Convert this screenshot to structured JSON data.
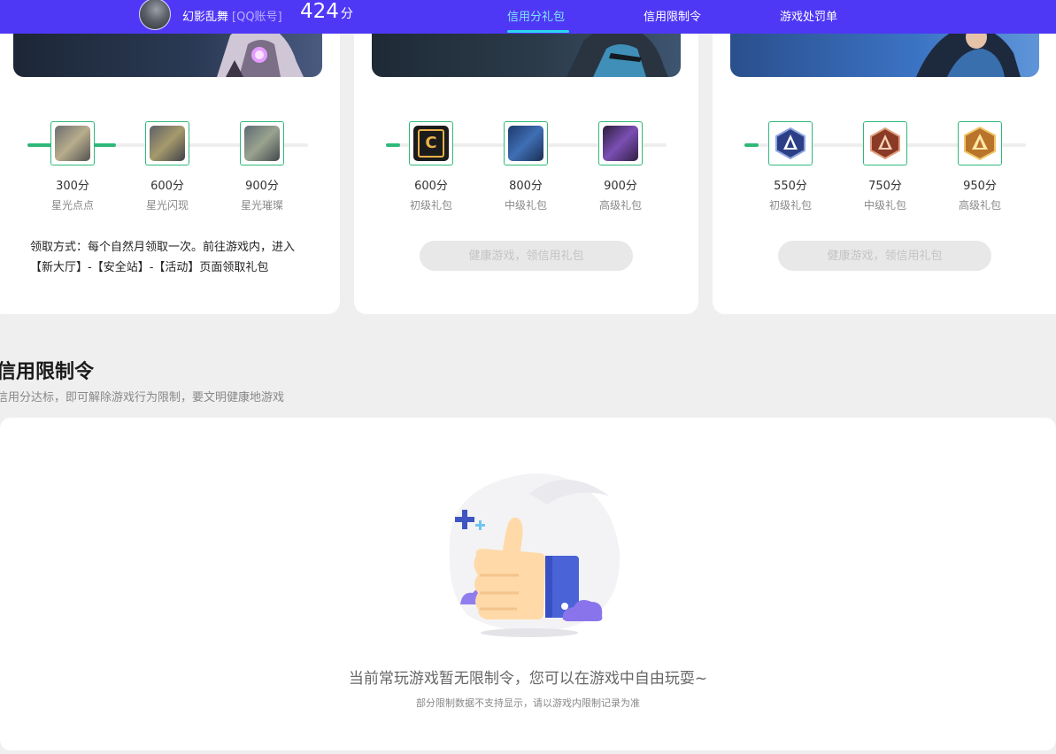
{
  "topbar": {
    "username": "幻影乱舞",
    "account_type": "[QQ账号]",
    "score": "424",
    "score_unit": "分",
    "nav": [
      {
        "label": "信用分礼包",
        "active": true
      },
      {
        "label": "信用限制令",
        "active": false
      },
      {
        "label": "游戏处罚单",
        "active": false
      }
    ]
  },
  "cards": [
    {
      "tiers": [
        {
          "points": "300分",
          "name": "星光点点"
        },
        {
          "points": "600分",
          "name": "星光闪现"
        },
        {
          "points": "900分",
          "name": "星光璀璨"
        }
      ],
      "progress": 0.3,
      "howto": "领取方式：每个自然月领取一次。前往游戏内，进入【新大厅】-【安全站】-【活动】页面领取礼包"
    },
    {
      "tiers": [
        {
          "points": "600分",
          "name": "初级礼包"
        },
        {
          "points": "800分",
          "name": "中级礼包"
        },
        {
          "points": "900分",
          "name": "高级礼包"
        }
      ],
      "progress": 0.05,
      "button": "健康游戏，领信用礼包"
    },
    {
      "tiers": [
        {
          "points": "550分",
          "name": "初级礼包"
        },
        {
          "points": "750分",
          "name": "中级礼包"
        },
        {
          "points": "950分",
          "name": "高级礼包"
        }
      ],
      "progress": 0.05,
      "button": "健康游戏，领信用礼包"
    }
  ],
  "restriction": {
    "title": "信用限制令",
    "subtitle": "信用分达标，即可解除游戏行为限制，要文明健康地游戏",
    "empty_main": "当前常玩游戏暂无限制令，您可以在游戏中自由玩耍~",
    "empty_sub": "部分限制数据不支持显示，请以游戏内限制记录为准"
  },
  "colors": {
    "topbar": "#4f38f5",
    "active_nav": "#7fe6ff",
    "progress": "#2fb879",
    "page_bg": "#efefef"
  }
}
